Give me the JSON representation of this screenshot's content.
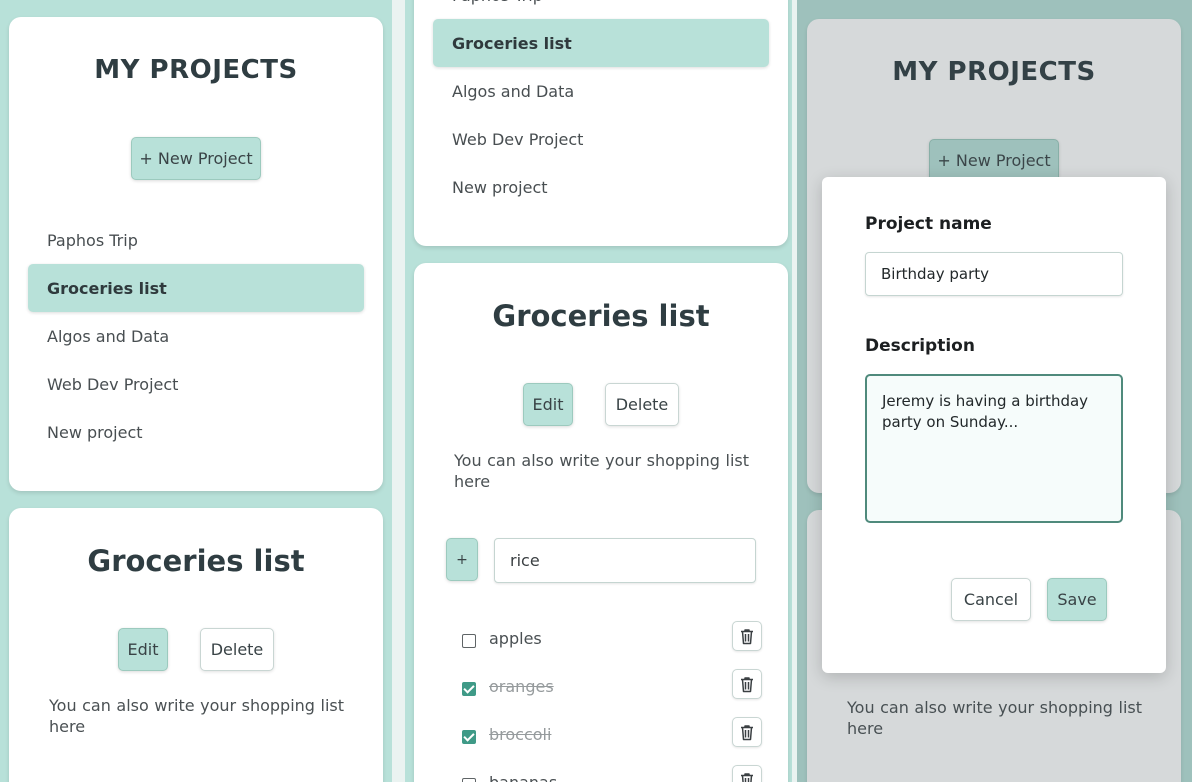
{
  "projects_panel": {
    "title": "MY PROJECTS",
    "new_project_label": "+ New Project",
    "items": [
      {
        "label": "Paphos Trip"
      },
      {
        "label": "Groceries list"
      },
      {
        "label": "Algos and Data"
      },
      {
        "label": "Web Dev Project"
      },
      {
        "label": "New project"
      }
    ],
    "active_item": "Groceries list"
  },
  "project_view": {
    "title": "Groceries list",
    "edit_label": "Edit",
    "delete_label": "Delete",
    "description": "You can also write your shopping list here",
    "add_button_label": "+",
    "add_input_value": "rice",
    "todos": [
      {
        "text": "apples",
        "checked": false
      },
      {
        "text": "oranges",
        "checked": true
      },
      {
        "text": "broccoli",
        "checked": true
      },
      {
        "text": "bananas",
        "checked": false
      }
    ]
  },
  "middle_panel_top_partial_label": "Paphos Trip",
  "edit_modal": {
    "name_label": "Project name",
    "name_value": "Birthday party",
    "description_label": "Description",
    "description_value": "Jeremy is having a birthday party on Sunday...",
    "cancel_label": "Cancel",
    "save_label": "Save"
  },
  "colors": {
    "accent": "#b8e1d9",
    "accent_border": "#9ccabe",
    "checkbox": "#3f9a87",
    "focused_border": "#4f8a7c",
    "title_text": "#2f3d42"
  },
  "icons": {
    "todo_delete": "trash-icon",
    "todo_checkbox": "checkbox"
  }
}
